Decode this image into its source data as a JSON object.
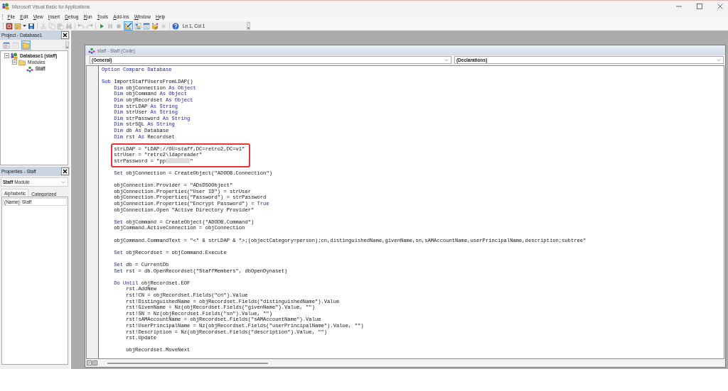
{
  "window": {
    "title": "Microsoft Visual Basic for Applications"
  },
  "menu": [
    "File",
    "Edit",
    "View",
    "Insert",
    "Debug",
    "Run",
    "Tools",
    "Add-Ins",
    "Window",
    "Help"
  ],
  "toolbar": {
    "groups": [
      [
        {
          "disabled": false,
          "pressed": false
        },
        {
          "disabled": false,
          "pressed": false
        },
        {
          "disabled": false,
          "pressed": false
        }
      ],
      [
        {
          "disabled": true,
          "pressed": false
        },
        {
          "disabled": true,
          "pressed": false
        },
        {
          "disabled": true,
          "pressed": false
        },
        {
          "disabled": true,
          "pressed": false
        }
      ],
      [
        {
          "disabled": true,
          "pressed": false
        },
        {
          "disabled": true,
          "pressed": false
        }
      ],
      [
        {
          "disabled": false,
          "pressed": false
        },
        {
          "disabled": true,
          "pressed": false
        },
        {
          "disabled": true,
          "pressed": false
        },
        {
          "disabled": false,
          "pressed": true
        },
        {
          "disabled": false,
          "pressed": false
        },
        {
          "disabled": false,
          "pressed": false
        },
        {
          "disabled": false,
          "pressed": false
        },
        {
          "disabled": true,
          "pressed": false
        }
      ],
      [
        {
          "disabled": false,
          "pressed": false
        }
      ]
    ],
    "position": "Ln 1, Col 1"
  },
  "project_panel": {
    "title": "Project - Database1",
    "tools": [
      {
        "disabled": false,
        "pressed": false
      },
      {
        "disabled": true,
        "pressed": false
      },
      {
        "disabled": false,
        "pressed": true
      }
    ],
    "tree": [
      {
        "label": "Database1 (staff)",
        "kind": "project",
        "expanded": true,
        "selected": false,
        "children": [
          {
            "label": "Modules",
            "kind": "folder",
            "expanded": true,
            "selected": false,
            "children": [
              {
                "label": "Staff",
                "kind": "module",
                "selected": true
              }
            ]
          }
        ]
      }
    ]
  },
  "properties_panel": {
    "title": "Properties - Staff",
    "object": "**Staff** Module",
    "tabs": [
      {
        "label": "Alphabetic",
        "selected": true
      },
      {
        "label": "Categorized",
        "selected": false
      }
    ],
    "rows": [
      {
        "name": "(Name)",
        "value": "Staff"
      }
    ]
  },
  "code_window": {
    "title": "staff - Staff (Code)",
    "object": "(General)",
    "procedure": "(Declarations)",
    "blocks": [
      {
        "highlighted": false,
        "lines": [
          {
            "tokens": [
              {
                "kind": "keyword",
                "text": "Option Compare Database"
              }
            ]
          }
        ]
      },
      {
        "highlighted": false,
        "lines": [
          {
            "tokens": [
              {
                "kind": "keyword",
                "text": "Sub"
              },
              {
                "kind": "plain",
                "text": " ImportStaffUsersFromLDAP()"
              }
            ],
            "children": [
              {
                "highlighted": false,
                "lines": [
                  {
                    "tokens": [
                      {
                        "kind": "keyword",
                        "text": "Dim"
                      },
                      {
                        "kind": "plain",
                        "text": " objConnection "
                      },
                      {
                        "kind": "keyword",
                        "text": "As Object"
                      }
                    ]
                  },
                  {
                    "tokens": [
                      {
                        "kind": "keyword",
                        "text": "Dim"
                      },
                      {
                        "kind": "plain",
                        "text": " objCommand "
                      },
                      {
                        "kind": "keyword",
                        "text": "As Object"
                      }
                    ]
                  },
                  {
                    "tokens": [
                      {
                        "kind": "keyword",
                        "text": "Dim"
                      },
                      {
                        "kind": "plain",
                        "text": " objRecordset "
                      },
                      {
                        "kind": "keyword",
                        "text": "As Object"
                      }
                    ]
                  },
                  {
                    "tokens": [
                      {
                        "kind": "keyword",
                        "text": "Dim"
                      },
                      {
                        "kind": "plain",
                        "text": " strLDAP "
                      },
                      {
                        "kind": "keyword",
                        "text": "As String"
                      }
                    ]
                  },
                  {
                    "tokens": [
                      {
                        "kind": "keyword",
                        "text": "Dim"
                      },
                      {
                        "kind": "plain",
                        "text": " strUser "
                      },
                      {
                        "kind": "keyword",
                        "text": "As String"
                      }
                    ]
                  },
                  {
                    "tokens": [
                      {
                        "kind": "keyword",
                        "text": "Dim"
                      },
                      {
                        "kind": "plain",
                        "text": " strPassword "
                      },
                      {
                        "kind": "keyword",
                        "text": "As String"
                      }
                    ]
                  },
                  {
                    "tokens": [
                      {
                        "kind": "keyword",
                        "text": "Dim"
                      },
                      {
                        "kind": "plain",
                        "text": " strSQL "
                      },
                      {
                        "kind": "keyword",
                        "text": "As String"
                      }
                    ]
                  },
                  {
                    "tokens": [
                      {
                        "kind": "keyword",
                        "text": "Dim"
                      },
                      {
                        "kind": "plain",
                        "text": " db "
                      },
                      {
                        "kind": "keyword",
                        "text": "As"
                      },
                      {
                        "kind": "plain",
                        "text": " Database"
                      }
                    ]
                  },
                  {
                    "tokens": [
                      {
                        "kind": "keyword",
                        "text": "Dim"
                      },
                      {
                        "kind": "plain",
                        "text": " rst "
                      },
                      {
                        "kind": "keyword",
                        "text": "As"
                      },
                      {
                        "kind": "plain",
                        "text": " Recordset"
                      }
                    ]
                  }
                ]
              },
              {
                "highlighted": true,
                "lines": [
                  {
                    "tokens": [
                      {
                        "kind": "plain",
                        "text": "strLDAP = \"LDAP://OU=staff,DC=retro2,DC=v1\""
                      }
                    ]
                  },
                  {
                    "tokens": [
                      {
                        "kind": "plain",
                        "text": "strUser = \"retro2\\ldapreader\""
                      }
                    ]
                  },
                  {
                    "tokens": [
                      {
                        "kind": "plain",
                        "text": "strPassword = \"pp"
                      },
                      {
                        "kind": "redacted"
                      },
                      {
                        "kind": "plain",
                        "text": "\""
                      }
                    ]
                  }
                ]
              },
              {
                "highlighted": false,
                "lines": [
                  {
                    "tokens": [
                      {
                        "kind": "keyword",
                        "text": "Set"
                      },
                      {
                        "kind": "plain",
                        "text": " objConnection = CreateObject(\"ADODB.Connection\")"
                      }
                    ]
                  }
                ]
              },
              {
                "highlighted": false,
                "lines": [
                  {
                    "tokens": [
                      {
                        "kind": "plain",
                        "text": "objConnection.Provider = \"ADsDSOObject\""
                      }
                    ]
                  },
                  {
                    "tokens": [
                      {
                        "kind": "plain",
                        "text": "objConnection.Properties(\"User ID\") = strUser"
                      }
                    ]
                  },
                  {
                    "tokens": [
                      {
                        "kind": "plain",
                        "text": "objConnection.Properties(\"Password\") = strPassword"
                      }
                    ]
                  },
                  {
                    "tokens": [
                      {
                        "kind": "plain",
                        "text": "objConnection.Properties(\"Encrypt Password\") = "
                      },
                      {
                        "kind": "keyword",
                        "text": "True"
                      }
                    ]
                  },
                  {
                    "tokens": [
                      {
                        "kind": "plain",
                        "text": "objConnection.Open \"Active Directory Provider\""
                      }
                    ]
                  }
                ]
              },
              {
                "highlighted": false,
                "lines": [
                  {
                    "tokens": [
                      {
                        "kind": "keyword",
                        "text": "Set"
                      },
                      {
                        "kind": "plain",
                        "text": " objCommand = CreateObject(\"ADODB.Command\")"
                      }
                    ]
                  },
                  {
                    "tokens": [
                      {
                        "kind": "plain",
                        "text": "objCommand.ActiveConnection = objConnection"
                      }
                    ]
                  }
                ]
              },
              {
                "highlighted": false,
                "lines": [
                  {
                    "tokens": [
                      {
                        "kind": "plain",
                        "text": "objCommand.CommandText = \"<\" & strLDAP & \">;(objectCategory=person);cn,distinguishedName,givenName,sn,sAMAccountName,userPrincipalName,description;subtree\""
                      }
                    ]
                  }
                ]
              },
              {
                "highlighted": false,
                "lines": [
                  {
                    "tokens": [
                      {
                        "kind": "keyword",
                        "text": "Set"
                      },
                      {
                        "kind": "plain",
                        "text": " objRecordset = objCommand.Execute"
                      }
                    ]
                  }
                ]
              },
              {
                "highlighted": false,
                "lines": [
                  {
                    "tokens": [
                      {
                        "kind": "keyword",
                        "text": "Set"
                      },
                      {
                        "kind": "plain",
                        "text": " db = CurrentDb"
                      }
                    ]
                  },
                  {
                    "tokens": [
                      {
                        "kind": "keyword",
                        "text": "Set"
                      },
                      {
                        "kind": "plain",
                        "text": " rst = db.OpenRecordset(\"StaffMembers\", dbOpenDynaset)"
                      }
                    ]
                  }
                ]
              },
              {
                "highlighted": false,
                "lines": [
                  {
                    "tokens": [
                      {
                        "kind": "keyword",
                        "text": "Do Until"
                      },
                      {
                        "kind": "plain",
                        "text": " objRecordset.EOF"
                      }
                    ],
                    "children": [
                      {
                        "highlighted": false,
                        "lines": [
                          {
                            "tokens": [
                              {
                                "kind": "plain",
                                "text": "rst.AddNew"
                              }
                            ]
                          },
                          {
                            "tokens": [
                              {
                                "kind": "plain",
                                "text": "rst!CN = objRecordset.Fields(\"cn\").Value"
                              }
                            ]
                          },
                          {
                            "tokens": [
                              {
                                "kind": "plain",
                                "text": "rst!DistinguishedName = objRecordset.Fields(\"distinguishedName\").Value"
                              }
                            ]
                          },
                          {
                            "tokens": [
                              {
                                "kind": "plain",
                                "text": "rst!GivenName = Nz(objRecordset.Fields(\"givenName\").Value, \"\")"
                              }
                            ]
                          },
                          {
                            "tokens": [
                              {
                                "kind": "plain",
                                "text": "rst!SN = Nz(objRecordset.Fields(\"sn\").Value, \"\")"
                              }
                            ]
                          },
                          {
                            "tokens": [
                              {
                                "kind": "plain",
                                "text": "rst!sAMAccountName = objRecordset.Fields(\"sAMAccountName\").Value"
                              }
                            ]
                          },
                          {
                            "tokens": [
                              {
                                "kind": "plain",
                                "text": "rst!UserPrincipalName = Nz(objRecordset.Fields(\"userPrincipalName\").Value, \"\")"
                              }
                            ]
                          },
                          {
                            "tokens": [
                              {
                                "kind": "plain",
                                "text": "rst!Description = Nz(objRecordset.Fields(\"description\").Value, \"\")"
                              }
                            ]
                          },
                          {
                            "tokens": [
                              {
                                "kind": "plain",
                                "text": "rst.Update"
                              }
                            ]
                          }
                        ]
                      },
                      {
                        "highlighted": false,
                        "lines": [
                          {
                            "tokens": [
                              {
                                "kind": "plain",
                                "text": "objRecordset.MoveNext"
                              }
                            ]
                          }
                        ]
                      }
                    ]
                  }
                ]
              }
            ]
          }
        ]
      }
    ]
  }
}
